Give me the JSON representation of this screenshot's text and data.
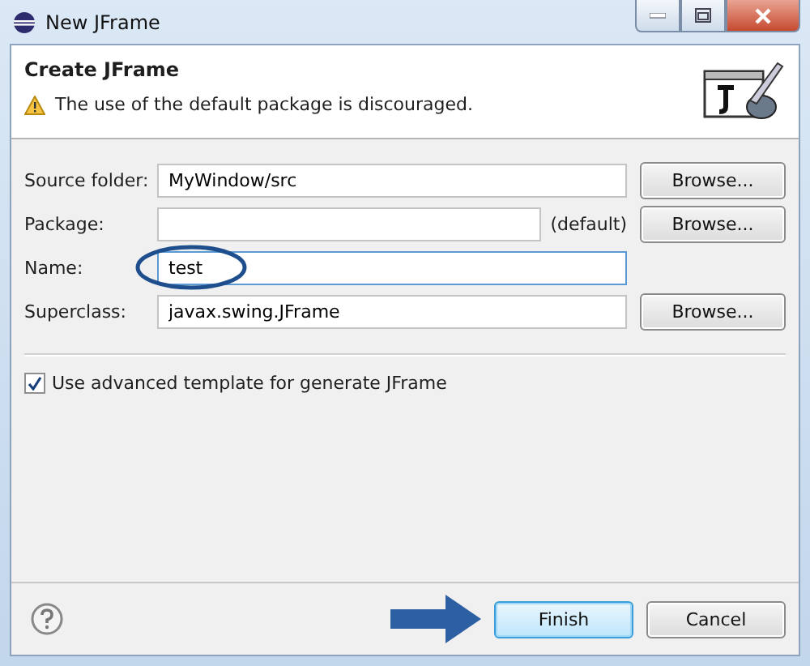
{
  "window": {
    "title": "New JFrame"
  },
  "banner": {
    "title": "Create JFrame",
    "message": "The use of the default package is discouraged."
  },
  "fields": [
    {
      "label": "Source folder:",
      "value": "MyWindow/src",
      "focused": false,
      "button": "Browse..."
    },
    {
      "label": "Package:",
      "focused": false,
      "suffix": "(default)",
      "button": "Browse..."
    },
    {
      "label": "Name:",
      "value": "test",
      "focused": true
    },
    {
      "label": "Superclass:",
      "value": "javax.swing.JFrame",
      "focused": false,
      "button": "Browse..."
    }
  ],
  "options": [
    {
      "label": "Use advanced template for generate JFrame",
      "checked": true
    }
  ],
  "buttons": [
    {
      "label": "Finish",
      "default": true
    },
    {
      "label": "Cancel",
      "default": false
    }
  ]
}
